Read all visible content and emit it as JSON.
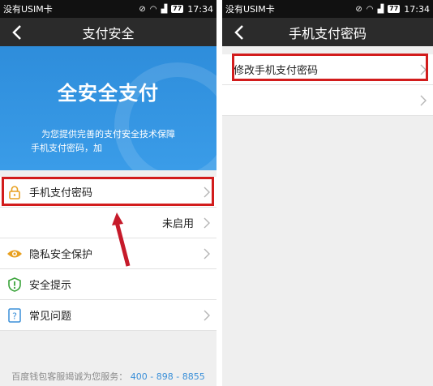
{
  "left": {
    "status": {
      "carrier": "没有USIM卡",
      "battery": "77",
      "time": "17:34"
    },
    "title": "支付安全",
    "banner": {
      "headline": "全安全支付",
      "line1": "为您提供完善的支付安全技术保障",
      "line2": "手机支付密码，加"
    },
    "items": [
      {
        "label": "手机支付密码",
        "icon": "lock-icon",
        "value": ""
      },
      {
        "label": "",
        "icon": "",
        "value": "未启用"
      },
      {
        "label": "隐私安全保护",
        "icon": "eye-icon",
        "value": ""
      },
      {
        "label": "安全提示",
        "icon": "shield-icon",
        "value": ""
      },
      {
        "label": "常见问题",
        "icon": "question-icon",
        "value": ""
      }
    ],
    "footer": {
      "text": "百度钱包客服竭诚为您服务：",
      "phone": "400 - 898 - 8855"
    }
  },
  "right": {
    "status": {
      "carrier": "没有USIM卡",
      "battery": "77",
      "time": "17:34"
    },
    "title": "手机支付密码",
    "items": [
      {
        "label": "修改手机支付密码"
      },
      {
        "label": ""
      }
    ]
  },
  "colors": {
    "highlight": "#d21c1c",
    "banner": "#3a9ce8",
    "titlebar": "#2b2b2b",
    "accent_icon": "#e8a020"
  }
}
